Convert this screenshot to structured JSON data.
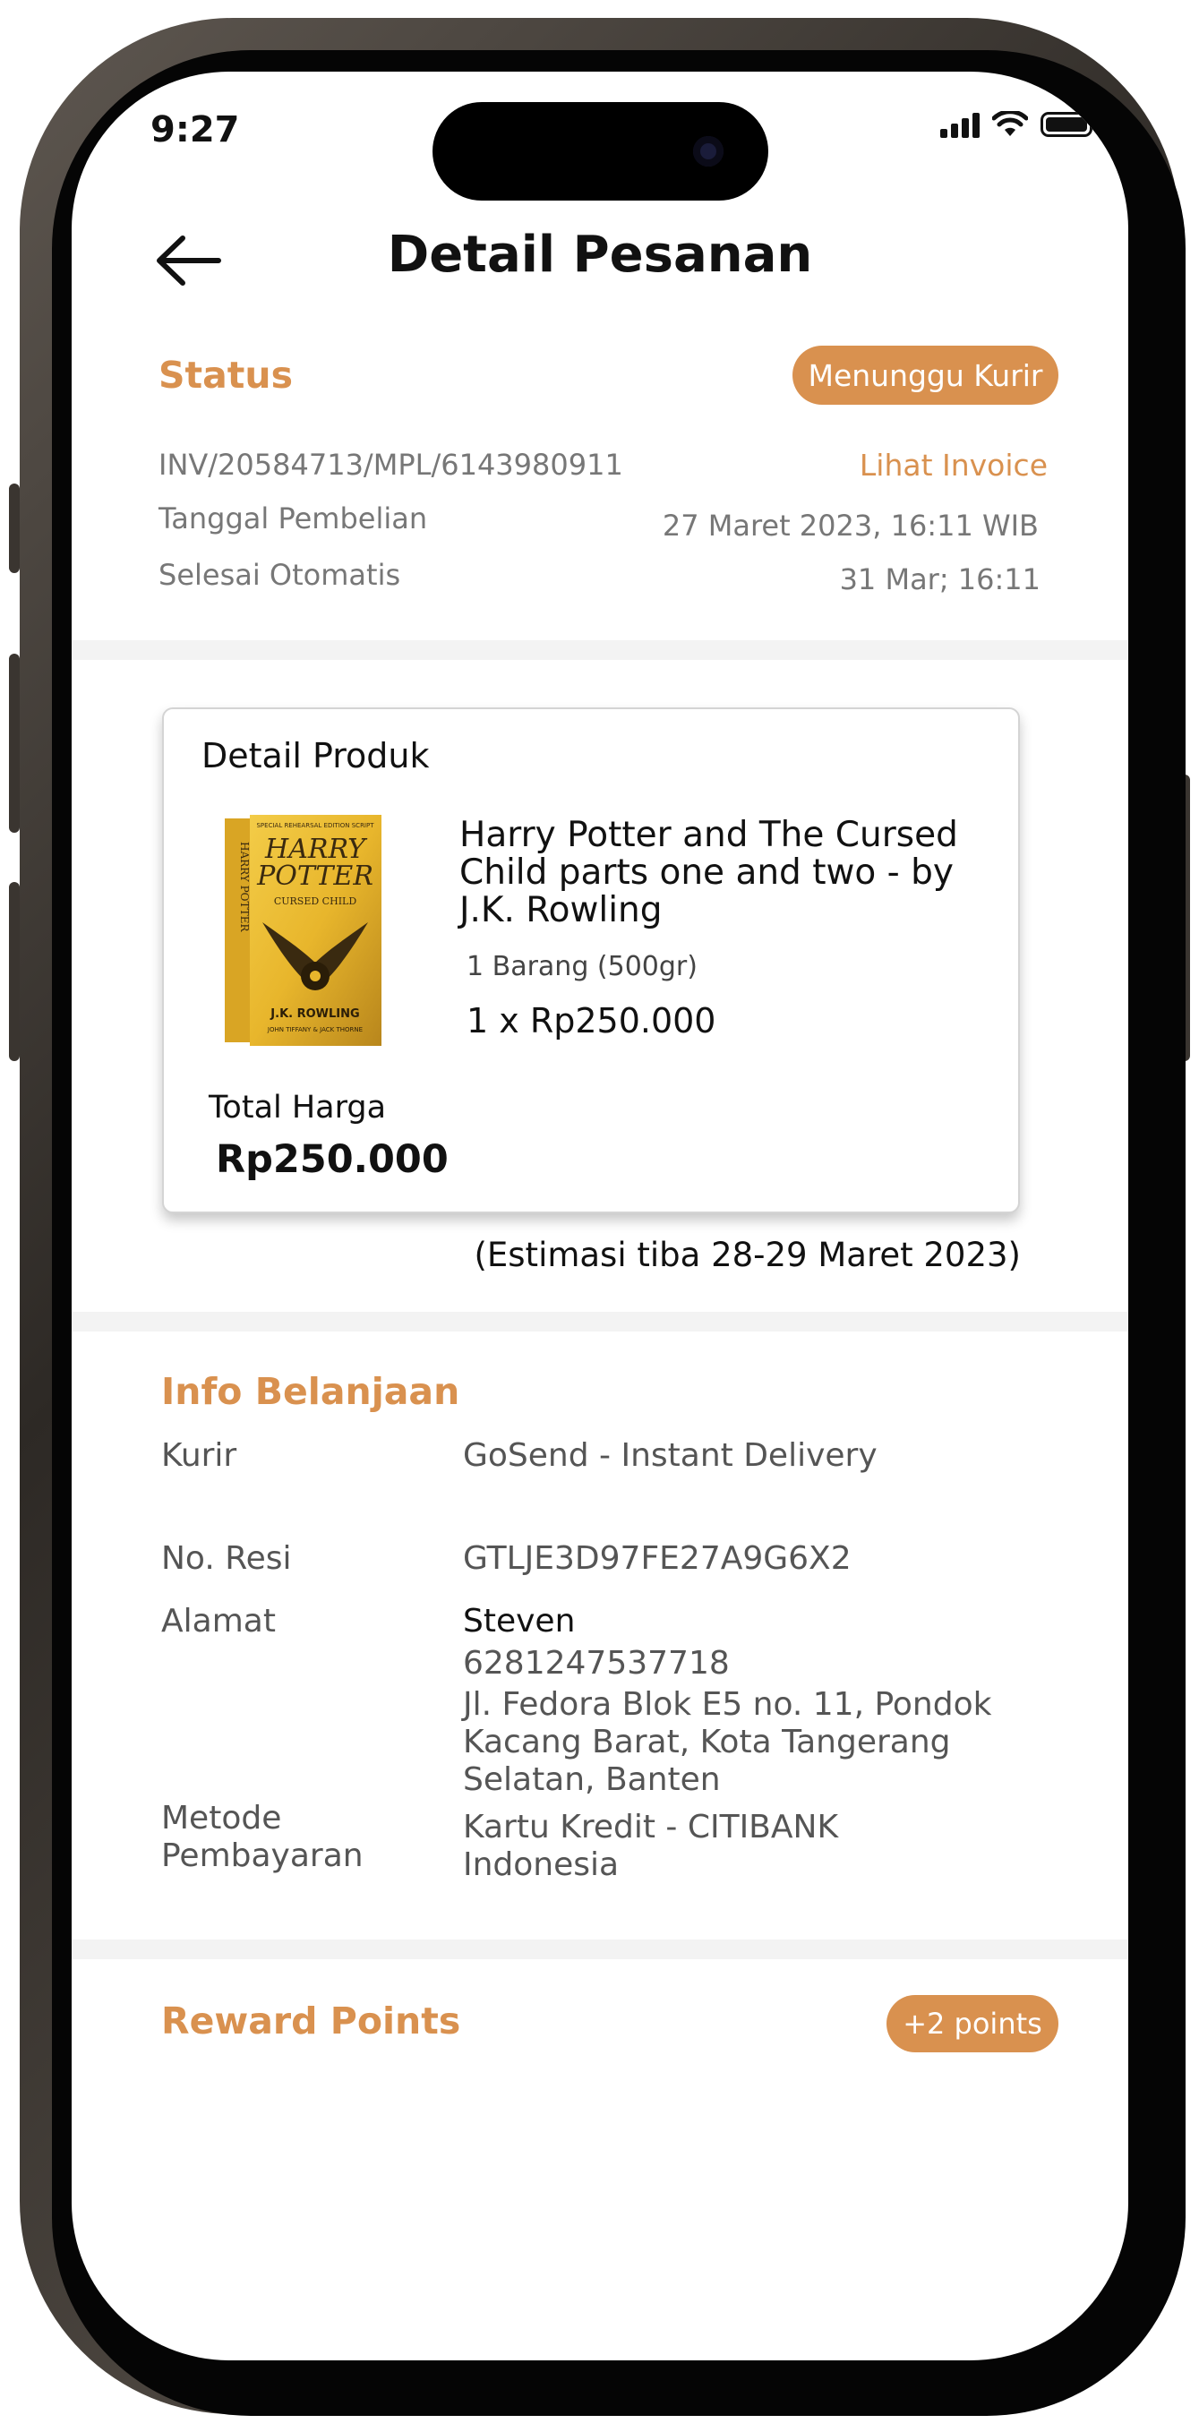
{
  "status_bar": {
    "time": "9:27"
  },
  "header": {
    "title": "Detail Pesanan",
    "back_icon": "arrow-left-icon"
  },
  "status": {
    "title": "Status",
    "badge": "Menunggu Kurir",
    "invoice_number": "INV/20584713/MPL/6143980911",
    "invoice_link": "Lihat Invoice",
    "purchase_date_label": "Tanggal Pembelian",
    "purchase_date_value": "27 Maret 2023, 16:11 WIB",
    "auto_complete_label": "Selesai Otomatis",
    "auto_complete_value": "31 Mar; 16:11"
  },
  "product": {
    "section_title": "Detail Produk",
    "name": "Harry Potter and The Cursed Child parts one and two - by J.K. Rowling",
    "quantity": "1 Barang (500gr)",
    "price_line": "1 x Rp250.000",
    "total_label": "Total Harga",
    "total_value": "Rp250.000",
    "eta": "(Estimasi tiba 28-29 Maret 2023)",
    "cover": {
      "top_banner": "SPECIAL REHEARSAL EDITION SCRIPT",
      "title_line1": "HARRY",
      "title_line2": "POTTER",
      "subtitle": "CURSED CHILD",
      "author": "J.K. ROWLING",
      "coauthors": "JOHN TIFFANY & JACK THORNE",
      "spine_title": "HARRY POTTER",
      "colors": {
        "gold": "#e8b62c",
        "dark": "#3a2a10"
      }
    }
  },
  "shopping_info": {
    "title": "Info Belanjaan",
    "courier_label": "Kurir",
    "courier_value": "GoSend - Instant Delivery",
    "receipt_label": "No. Resi",
    "receipt_value": "GTLJE3D97FE27A9G6X2",
    "address_label": "Alamat",
    "address_name": "Steven",
    "address_phone": "6281247537718",
    "address_street": "Jl. Fedora Blok E5 no. 11, Pondok Kacang Barat, Kota Tangerang Selatan, Banten",
    "payment_label": "Metode Pembayaran",
    "payment_value": "Kartu Kredit - CITIBANK Indonesia"
  },
  "rewards": {
    "title": "Reward Points",
    "badge": "+2 points"
  },
  "colors": {
    "accent": "#d9914f",
    "divider": "#f3f3f3",
    "text_muted": "#777777"
  }
}
